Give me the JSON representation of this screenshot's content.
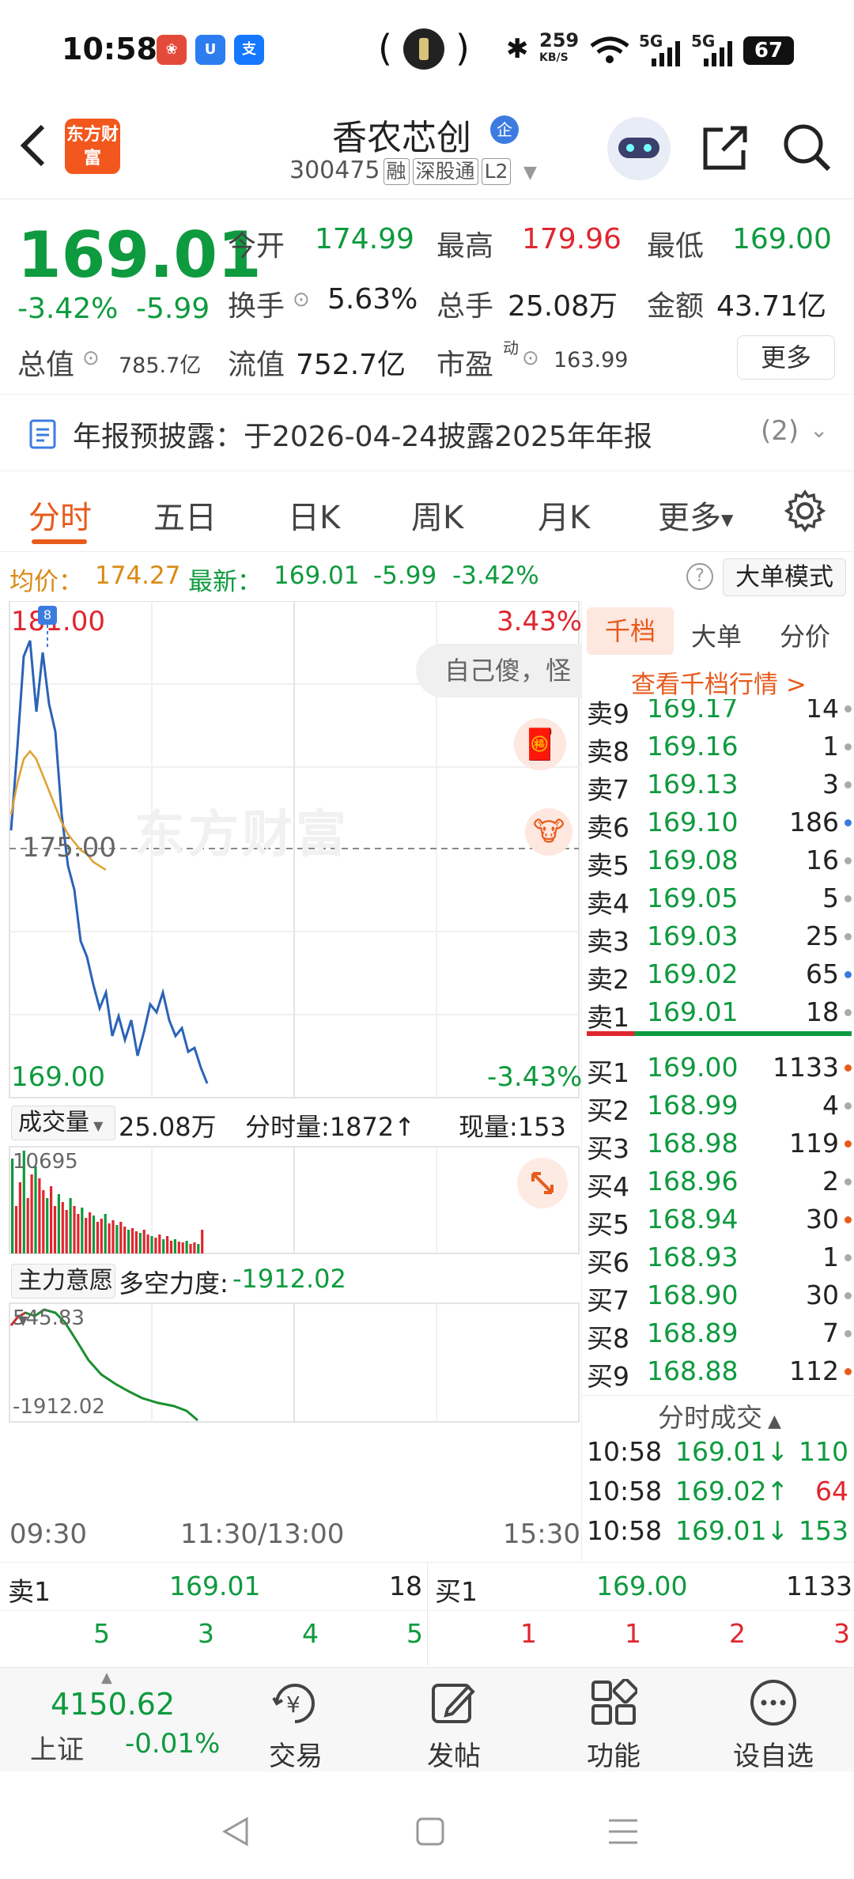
{
  "status_bar": {
    "time": "10:58",
    "net_speed": "259",
    "net_unit": "KB/S",
    "signal1": "5G",
    "signal2": "5G",
    "battery": "67"
  },
  "header": {
    "logo_text": "东方财富",
    "stock_name": "香农芯创",
    "corp_badge": "企",
    "code": "300475",
    "tag_margin": "融",
    "tag_connect": "深股通",
    "tag_level": "L2"
  },
  "quote": {
    "price": "169.01",
    "change_pct": "-3.42%",
    "change": "-5.99",
    "open_label": "今开",
    "open": "174.99",
    "high_label": "最高",
    "high": "179.96",
    "low_label": "最低",
    "low": "169.00",
    "turnover_label": "换手",
    "turnover": "5.63%",
    "volume_label": "总手",
    "volume": "25.08万",
    "amount_label": "金额",
    "amount": "43.71亿",
    "mktcap_label": "总值",
    "mktcap": "785.7亿",
    "float_label": "流值",
    "float_cap": "752.7亿",
    "pe_label": "市盈",
    "pe_sup": "动",
    "pe": "163.99",
    "more_label": "更多"
  },
  "notice": {
    "text": "年报预披露：于2026-04-24披露2025年年报",
    "count": "(2)"
  },
  "tabs": [
    "分时",
    "五日",
    "日K",
    "周K",
    "月K",
    "更多"
  ],
  "info_row": {
    "avg_label": "均价：",
    "avg_value": "174.27",
    "latest_label": "最新：",
    "latest_value": "169.01",
    "latest_change": "-5.99",
    "latest_pct": "-3.42%",
    "mode_button": "大单模式"
  },
  "chart": {
    "max_price": "181.00",
    "max_pct": "3.43%",
    "mid_price": "175.00",
    "min_price": "169.00",
    "min_pct": "-3.43%",
    "watermark": "东方财富",
    "comment": "自己傻，怪",
    "volume_label": "成交量",
    "volume_total": "25.08万",
    "tick_volume": "分时量:1872↑",
    "current_volume": "现量:153",
    "vol_max": "10695",
    "indicator_label": "主力意愿",
    "indicator_value_label": "多空力度:",
    "indicator_value": "-1912.02",
    "ind_max": "545.83",
    "ind_min": "-1912.02",
    "time_start": "09:30",
    "time_mid": "11:30/13:00",
    "time_end": "15:30"
  },
  "chart_data": {
    "type": "line",
    "title": "",
    "xlabel": "",
    "ylabel": "",
    "ylim": [
      169.0,
      181.0
    ],
    "series": [
      {
        "name": "",
        "values": [
          175.4,
          177.5,
          179.8,
          180.2,
          178.4,
          179.9,
          178.6,
          177.9,
          175.8,
          174.5,
          173.9,
          172.6,
          172.2,
          171.5,
          170.9,
          171.3,
          170.2,
          170.7,
          170.1,
          170.6,
          169.7,
          170.3,
          171.0,
          170.8,
          171.3,
          170.6,
          170.2,
          170.4,
          169.8,
          169.9,
          169.4,
          169.0
        ]
      },
      {
        "name": "",
        "values": [
          175.8,
          176.6,
          177.2,
          177.4,
          177.2,
          176.8,
          176.4,
          176.0,
          175.6,
          175.3,
          175.1,
          174.9,
          174.8,
          174.6,
          174.5,
          174.4
        ]
      }
    ]
  },
  "book_tabs": [
    "千档",
    "大单",
    "分价"
  ],
  "book_link": "查看千档行情 >",
  "asks": [
    {
      "label": "卖9",
      "price": "169.17",
      "vol": "14"
    },
    {
      "label": "卖8",
      "price": "169.16",
      "vol": "1"
    },
    {
      "label": "卖7",
      "price": "169.13",
      "vol": "3"
    },
    {
      "label": "卖6",
      "price": "169.10",
      "vol": "186"
    },
    {
      "label": "卖5",
      "price": "169.08",
      "vol": "16"
    },
    {
      "label": "卖4",
      "price": "169.05",
      "vol": "5"
    },
    {
      "label": "卖3",
      "price": "169.03",
      "vol": "25"
    },
    {
      "label": "卖2",
      "price": "169.02",
      "vol": "65"
    },
    {
      "label": "卖1",
      "price": "169.01",
      "vol": "18"
    }
  ],
  "bids": [
    {
      "label": "买1",
      "price": "169.00",
      "vol": "1133"
    },
    {
      "label": "买2",
      "price": "168.99",
      "vol": "4"
    },
    {
      "label": "买3",
      "price": "168.98",
      "vol": "119"
    },
    {
      "label": "买4",
      "price": "168.96",
      "vol": "2"
    },
    {
      "label": "买5",
      "price": "168.94",
      "vol": "30"
    },
    {
      "label": "买6",
      "price": "168.93",
      "vol": "1"
    },
    {
      "label": "买7",
      "price": "168.90",
      "vol": "30"
    },
    {
      "label": "买8",
      "price": "168.89",
      "vol": "7"
    },
    {
      "label": "买9",
      "price": "168.88",
      "vol": "112"
    }
  ],
  "ticks_title": "分时成交",
  "ticks": [
    {
      "time": "10:58",
      "price": "169.01↓",
      "vol": "110"
    },
    {
      "time": "10:58",
      "price": "169.02↑",
      "vol": "64"
    },
    {
      "time": "10:58",
      "price": "169.01↓",
      "vol": "153"
    }
  ],
  "summary": {
    "sell_label": "卖1",
    "sell_price": "169.01",
    "sell_vol": "18",
    "buy_label": "买1",
    "buy_price": "169.00",
    "buy_vol": "1133",
    "sell_nums": [
      "5",
      "3",
      "4",
      "5"
    ],
    "buy_nums": [
      "1",
      "1",
      "2",
      "3"
    ]
  },
  "bottom_nav": {
    "index_value": "4150.62",
    "index_name": "上证",
    "index_pct": "-0.01%",
    "trade": "交易",
    "post": "发帖",
    "func": "功能",
    "watch": "设自选"
  }
}
